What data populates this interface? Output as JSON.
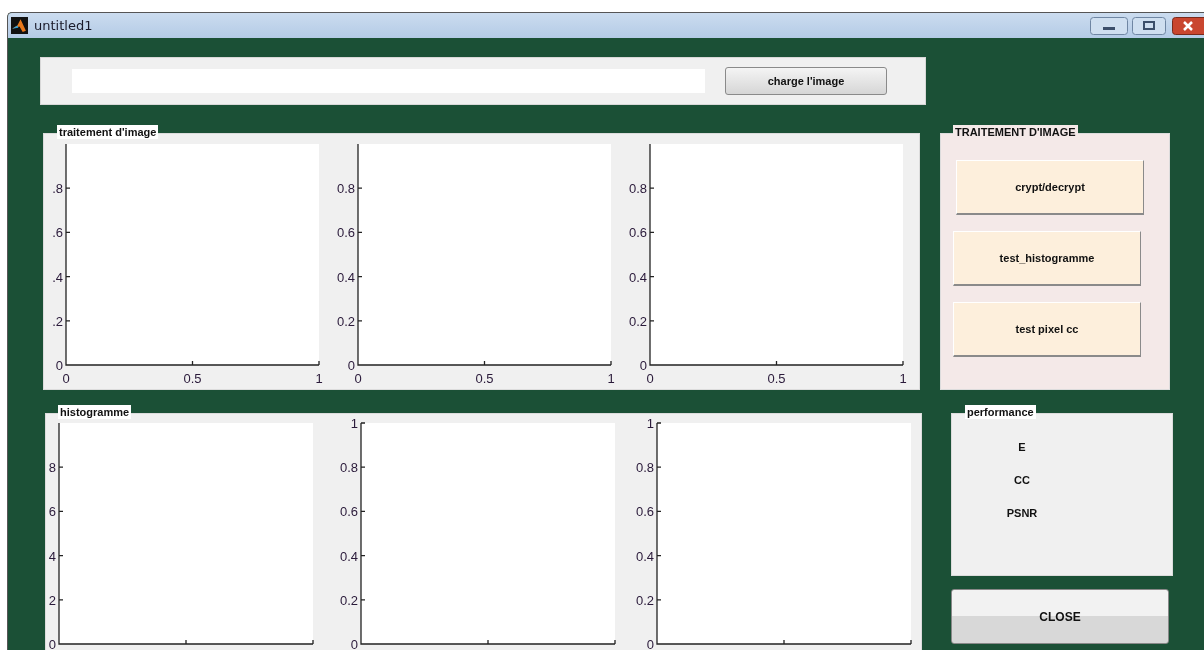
{
  "window": {
    "title": "untitled1"
  },
  "file_bar": {
    "button": "charge l'image"
  },
  "image_panel": {
    "title": "traitement d'image",
    "axes": [
      {
        "chart_data": {
          "type": "line",
          "xlim": [
            0,
            1
          ],
          "ylim": [
            0,
            1
          ],
          "xticks": [
            {
              "value": 0,
              "label": "0"
            },
            {
              "value": 0.5,
              "label": "0.5"
            },
            {
              "value": 1,
              "label": "1"
            }
          ],
          "yticks": [
            {
              "value": 0.8,
              "label": ".8"
            },
            {
              "value": 0.6,
              "label": ".6"
            },
            {
              "value": 0.4,
              "label": ".4"
            },
            {
              "value": 0.2,
              "label": ".2"
            },
            {
              "value": 0,
              "label": "0"
            }
          ]
        }
      },
      {
        "chart_data": {
          "type": "line",
          "xlim": [
            0,
            1
          ],
          "ylim": [
            0,
            1
          ],
          "xticks": [
            {
              "value": 0,
              "label": "0"
            },
            {
              "value": 0.5,
              "label": "0.5"
            },
            {
              "value": 1,
              "label": "1"
            }
          ],
          "yticks": [
            {
              "value": 0.8,
              "label": "0.8"
            },
            {
              "value": 0.6,
              "label": "0.6"
            },
            {
              "value": 0.4,
              "label": "0.4"
            },
            {
              "value": 0.2,
              "label": "0.2"
            },
            {
              "value": 0,
              "label": "0"
            }
          ]
        }
      },
      {
        "chart_data": {
          "type": "line",
          "xlim": [
            0,
            1
          ],
          "ylim": [
            0,
            1
          ],
          "xticks": [
            {
              "value": 0,
              "label": "0"
            },
            {
              "value": 0.5,
              "label": "0.5"
            },
            {
              "value": 1,
              "label": "1"
            }
          ],
          "yticks": [
            {
              "value": 0.8,
              "label": "0.8"
            },
            {
              "value": 0.6,
              "label": "0.6"
            },
            {
              "value": 0.4,
              "label": "0.4"
            },
            {
              "value": 0.2,
              "label": "0.2"
            },
            {
              "value": 0,
              "label": "0"
            }
          ]
        }
      }
    ]
  },
  "histogram_panel": {
    "title": "histogramme",
    "axes": [
      {
        "kind": "top_cut",
        "tick_labels": [
          "8",
          "6",
          "4",
          "2",
          "0"
        ]
      },
      {
        "kind": "full",
        "tick_labels": [
          "1",
          "0.8",
          "0.6",
          "0.4",
          "0.2",
          "0"
        ]
      },
      {
        "kind": "full",
        "tick_labels": [
          "1",
          "0.8",
          "0.6",
          "0.4",
          "0.2",
          "0"
        ]
      }
    ]
  },
  "processing_panel": {
    "title": "TRAITEMENT D'IMAGE",
    "buttons": [
      "crypt/decrypt",
      "test_histogramme",
      "test pixel cc"
    ]
  },
  "performance_panel": {
    "title": "performance",
    "metrics": [
      "E",
      "CC",
      "PSNR"
    ]
  },
  "close_button": "CLOSE"
}
